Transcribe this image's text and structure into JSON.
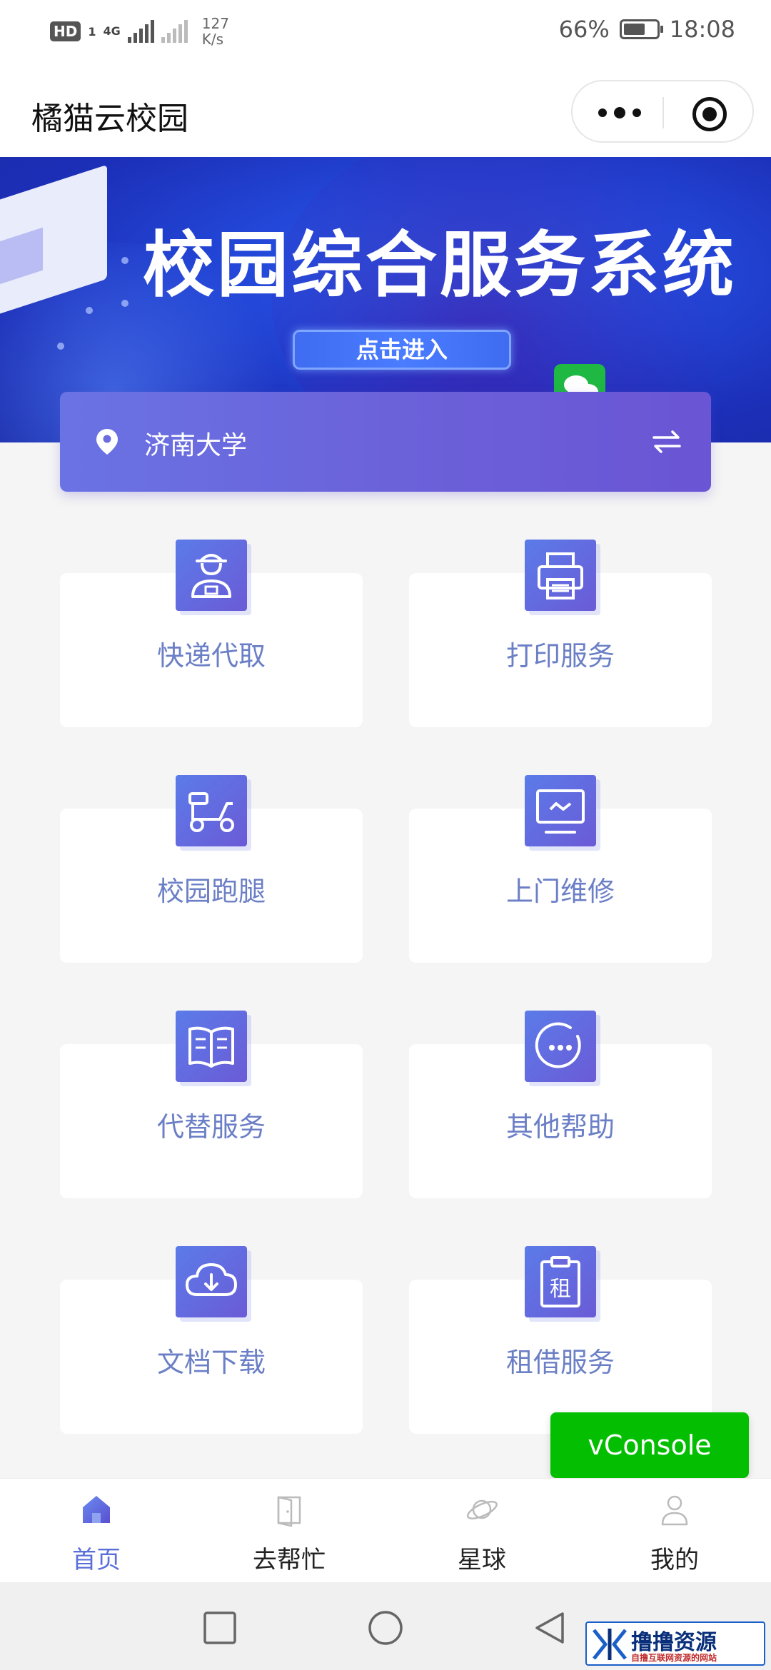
{
  "status_bar": {
    "hd": "HD",
    "sim": "1",
    "network": "4G",
    "speed_value": "127",
    "speed_unit": "K/s",
    "battery_percent": "66%",
    "battery_level": 0.66,
    "time": "18:08"
  },
  "nav": {
    "title": "橘猫云校园"
  },
  "banner": {
    "title": "校园综合服务系统",
    "button": "点击进入"
  },
  "location": {
    "name": "济南大学"
  },
  "services": [
    {
      "label": "快递代取",
      "icon": "delivery-person-icon"
    },
    {
      "label": "打印服务",
      "icon": "printer-icon"
    },
    {
      "label": "校园跑腿",
      "icon": "scooter-icon"
    },
    {
      "label": "上门维修",
      "icon": "monitor-icon"
    },
    {
      "label": "代替服务",
      "icon": "book-icon"
    },
    {
      "label": "其他帮助",
      "icon": "more-circle-icon"
    },
    {
      "label": "文档下载",
      "icon": "cloud-download-icon"
    },
    {
      "label": "租借服务",
      "icon": "rent-clipboard-icon",
      "icon_text": "租"
    }
  ],
  "vconsole": "vConsole",
  "tabs": [
    {
      "label": "首页",
      "icon": "home-icon",
      "active": true
    },
    {
      "label": "去帮忙",
      "icon": "door-icon",
      "active": false
    },
    {
      "label": "星球",
      "icon": "planet-icon",
      "active": false
    },
    {
      "label": "我的",
      "icon": "user-icon",
      "active": false
    }
  ],
  "watermark": {
    "title": "撸撸资源",
    "subtitle": "自撸互联网资源的网站",
    "mark": "®"
  },
  "colors": {
    "accent": "#5a6fd8",
    "card_label": "#6b7fc6",
    "vconsole": "#04be02"
  }
}
